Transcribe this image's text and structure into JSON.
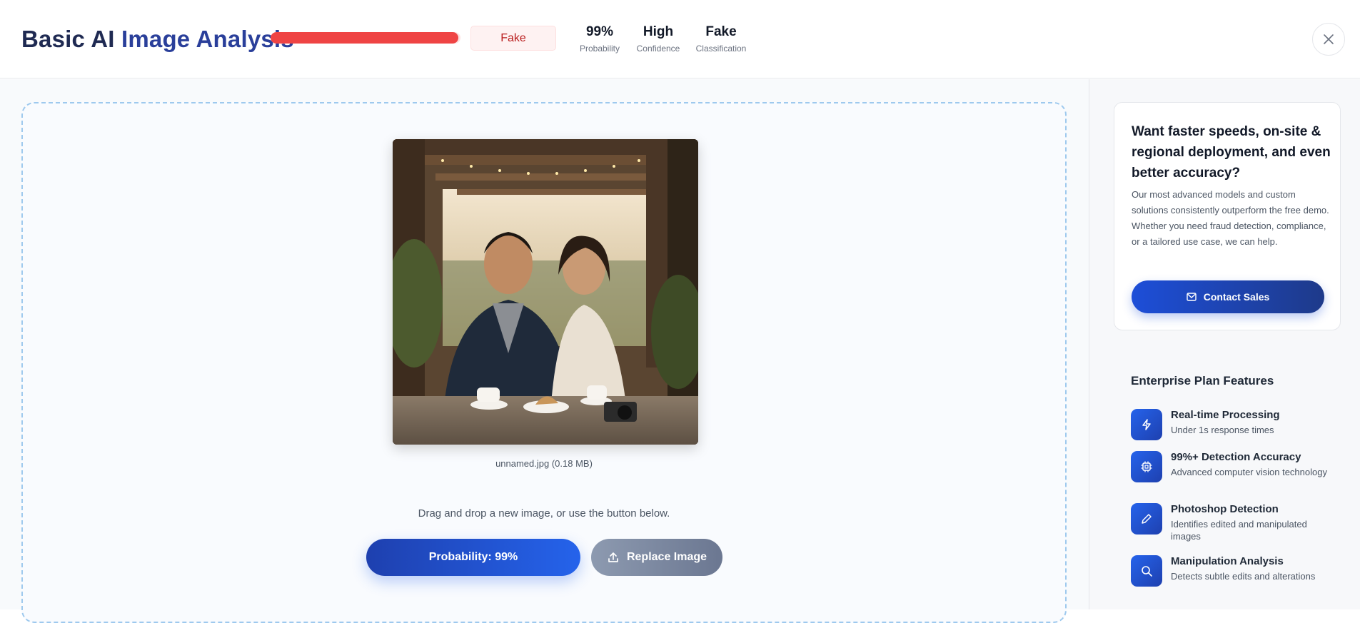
{
  "header": {
    "title_main": "Basic AI",
    "title_accent": "Image Analysis",
    "probability_fill": 0.99,
    "verdict_badge": "Fake",
    "stats": [
      {
        "value": "99%",
        "label": "Probability"
      },
      {
        "value": "High",
        "label": "Confidence"
      },
      {
        "value": "Fake",
        "label": "Classification"
      }
    ],
    "close_icon": "close-icon"
  },
  "main": {
    "file_info": "unnamed.jpg (0.18 MB)",
    "hint": "Drag and drop a new image, or use the button below.",
    "probability_button": "Probability: 99%",
    "replace_button": "Replace Image",
    "replace_icon": "upload-icon"
  },
  "sidebar": {
    "cta": {
      "title": "Want faster speeds, on-site & regional deployment, and even better accuracy?",
      "body": "Our most advanced models and custom solutions consistently outperform the free demo. Whether you need fraud detection, compliance, or a tailored use case, we can help.",
      "button": "Contact Sales",
      "button_icon": "mail-icon"
    },
    "features_heading": "Enterprise Plan Features",
    "features": [
      {
        "title": "Real-time Processing",
        "desc": "Under 1s response times",
        "icon": "lightning-icon"
      },
      {
        "title": "99%+ Detection Accuracy",
        "desc": "Advanced computer vision technology",
        "icon": "chip-icon"
      },
      {
        "title": "Photoshop Detection",
        "desc": "Identifies edited and manipulated images",
        "icon": "pencil-icon"
      },
      {
        "title": "Manipulation Analysis",
        "desc": "Detects subtle edits and alterations",
        "icon": "search-icon"
      }
    ]
  },
  "colors": {
    "danger": "#ef4444",
    "primary": "#1d4ed8",
    "title": "#1f2a52"
  }
}
